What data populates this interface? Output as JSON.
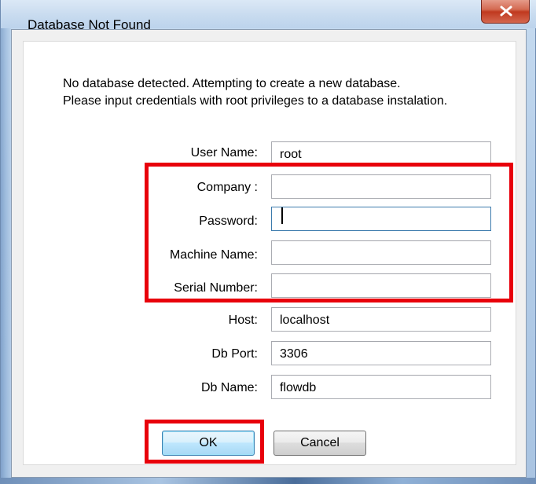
{
  "window": {
    "title": "Database Not Found",
    "close_icon": "close-x-icon"
  },
  "message": {
    "line1": "No database detected.  Attempting to create a new database.",
    "line2": "Please input credentials with root privileges to a database instalation."
  },
  "form": {
    "fields": [
      {
        "label": "User Name:",
        "value": "root"
      },
      {
        "label": "Company :",
        "value": ""
      },
      {
        "label": "Password:",
        "value": ""
      },
      {
        "label": "Machine Name:",
        "value": ""
      },
      {
        "label": "Serial Number:",
        "value": ""
      },
      {
        "label": "Host:",
        "value": "localhost"
      },
      {
        "label": "Db Port:",
        "value": "3306"
      },
      {
        "label": "Db Name:",
        "value": "flowdb"
      }
    ]
  },
  "buttons": {
    "ok_label": "OK",
    "cancel_label": "Cancel"
  },
  "annotations": {
    "highlight_color": "#e8000b"
  }
}
